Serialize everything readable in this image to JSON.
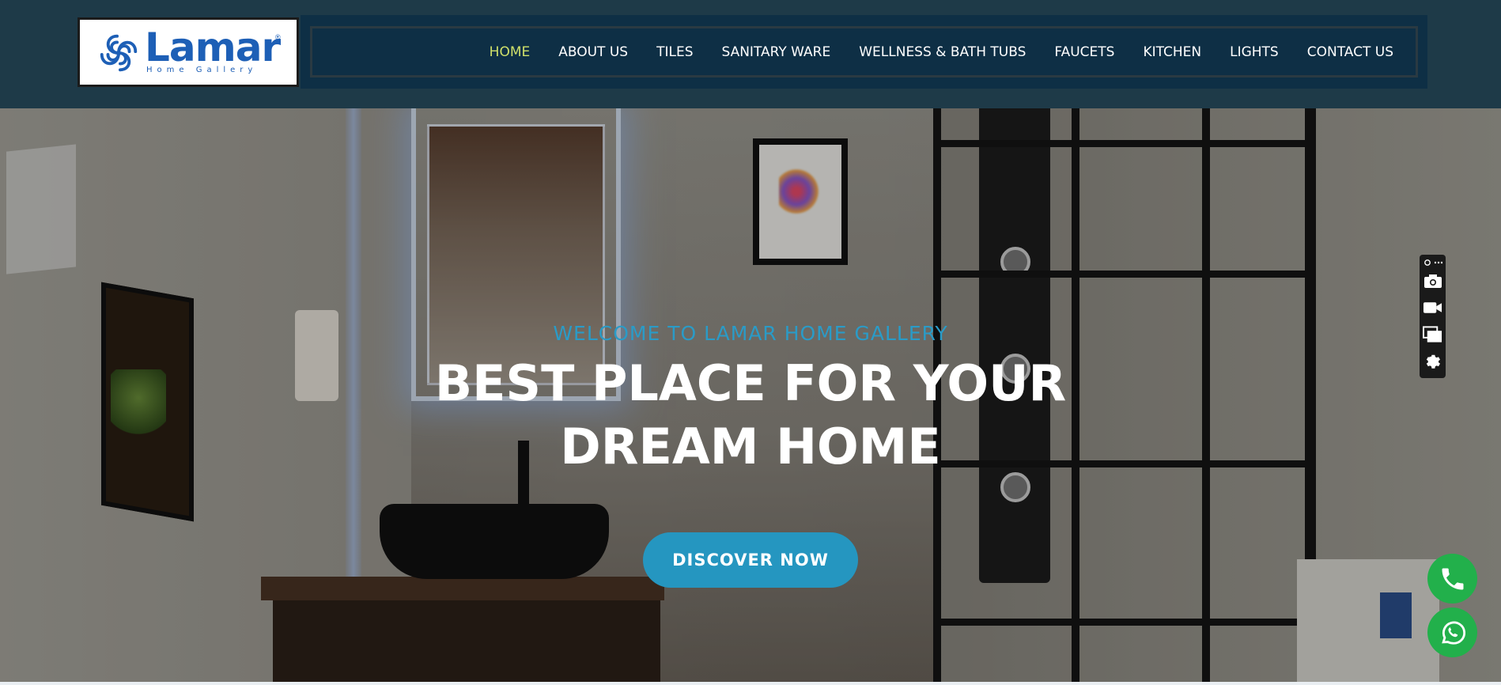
{
  "brand": {
    "name": "Lamar",
    "tagline": "Home Gallery",
    "registered": "®",
    "color": "#1d5fb6"
  },
  "nav": {
    "items": [
      {
        "label": "HOME",
        "active": true
      },
      {
        "label": "ABOUT US"
      },
      {
        "label": "TILES"
      },
      {
        "label": "SANITARY WARE"
      },
      {
        "label": "WELLNESS & BATH TUBS"
      },
      {
        "label": "FAUCETS"
      },
      {
        "label": "KITCHEN"
      },
      {
        "label": "LIGHTS"
      },
      {
        "label": "CONTACT US"
      }
    ],
    "active_color": "#cfe06a"
  },
  "hero": {
    "kicker": "WELCOME TO LAMAR HOME GALLERY",
    "title_line1": "BEST PLACE FOR YOUR",
    "title_line2": "DREAM HOME",
    "cta_label": "DISCOVER NOW",
    "accent_color": "#2596c0"
  },
  "side_toolbar": {
    "icons": [
      "link-more-icon",
      "camera-icon",
      "video-icon",
      "windows-icon",
      "settings-icon"
    ]
  },
  "floating_buttons": [
    {
      "icon": "phone-icon",
      "color": "#22b04b"
    },
    {
      "icon": "whatsapp-icon",
      "color": "#22b04b"
    }
  ]
}
